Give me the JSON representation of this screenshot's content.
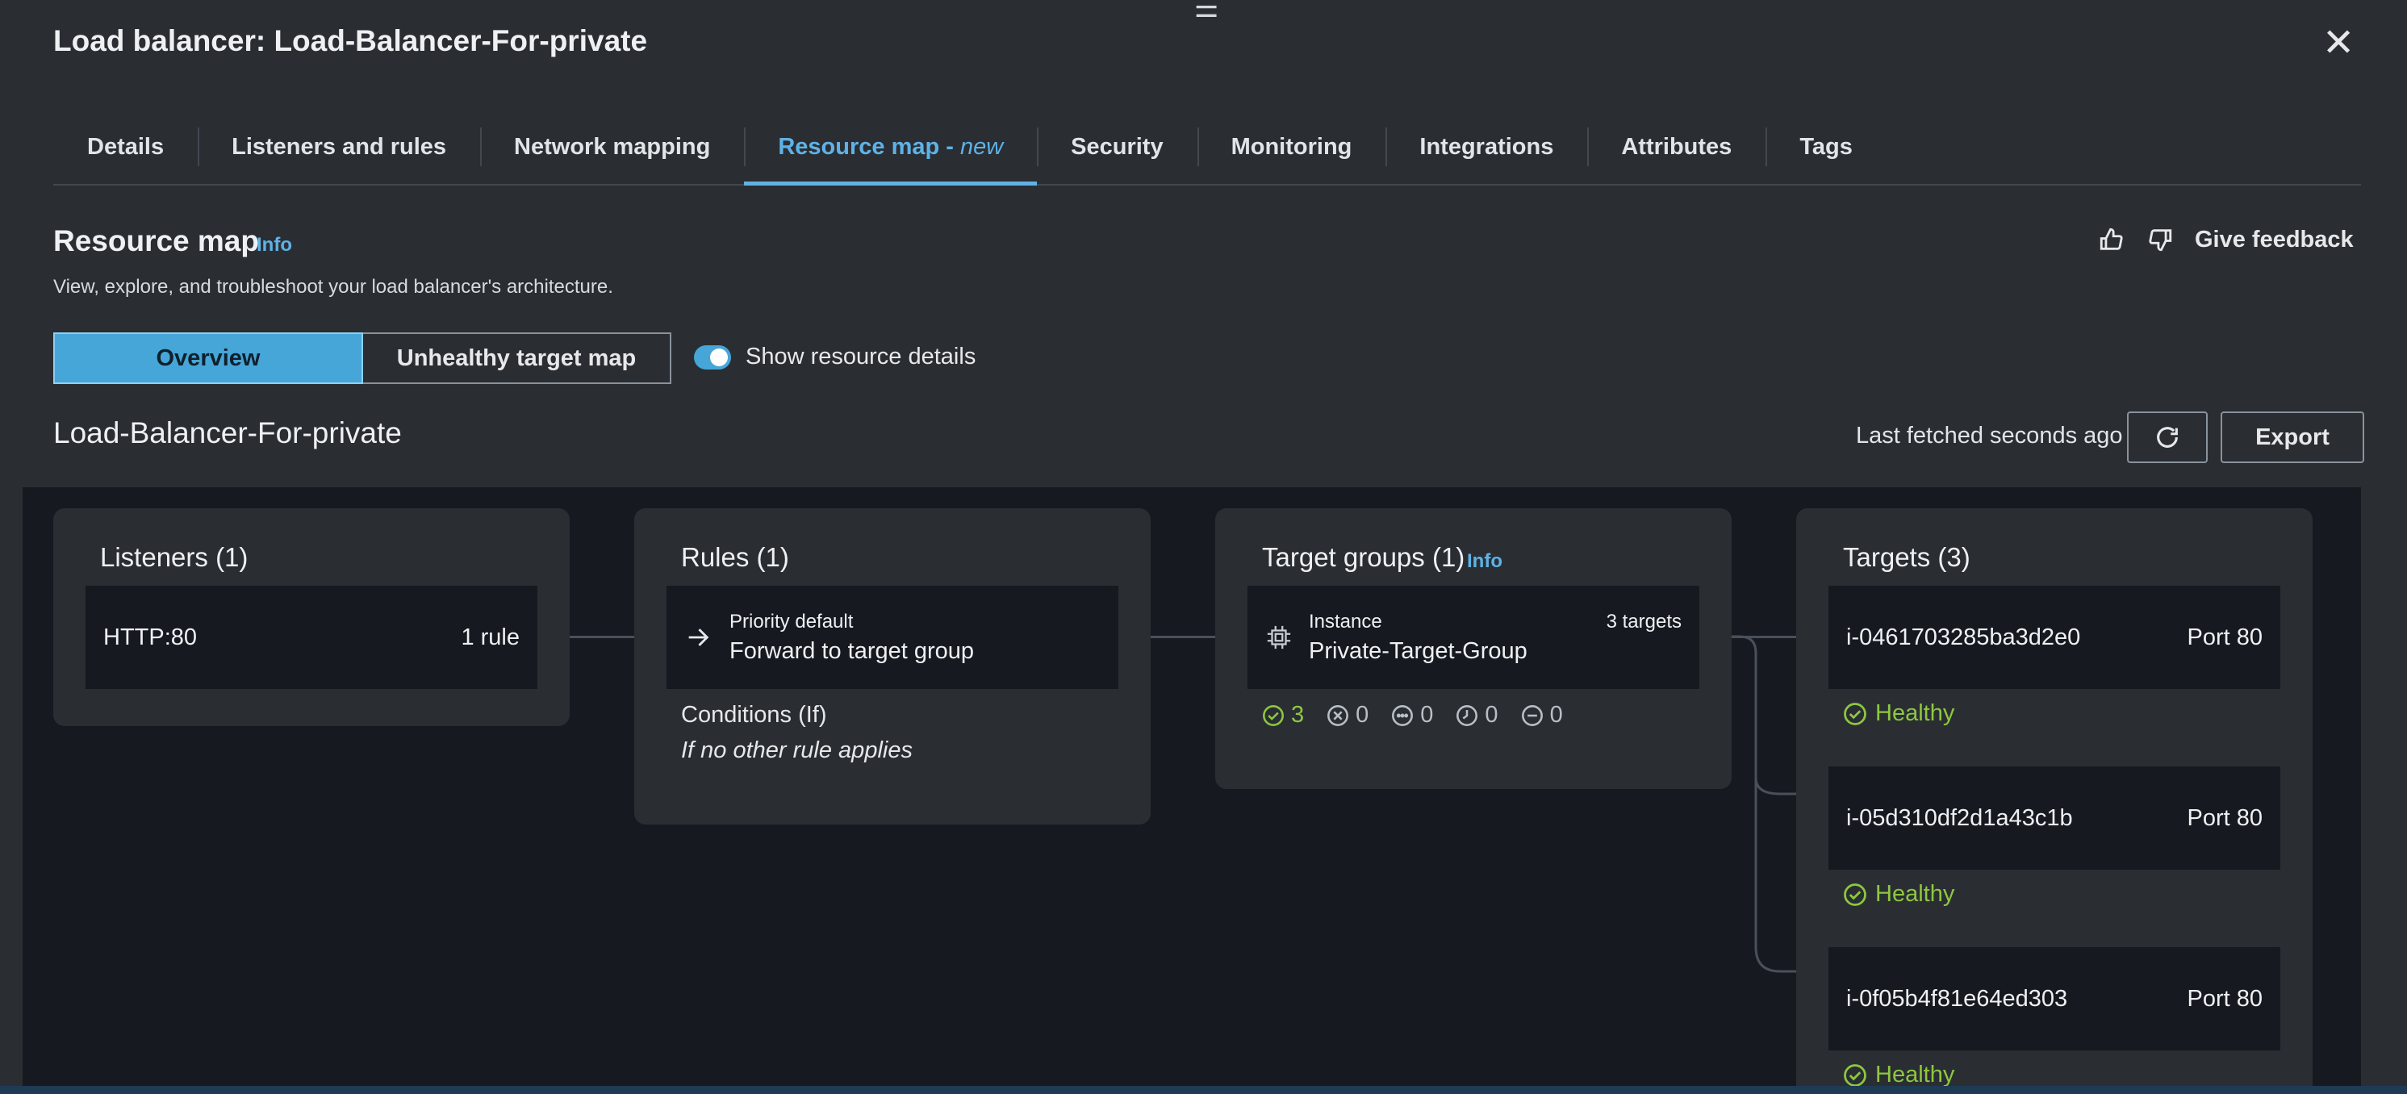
{
  "panel": {
    "title": "Load balancer: Load-Balancer-For-private",
    "drag_handle": "☰",
    "close_glyph": "✕"
  },
  "tabs": [
    {
      "label": "Details"
    },
    {
      "label": "Listeners and rules"
    },
    {
      "label": "Network mapping"
    },
    {
      "label": "Resource map -",
      "suffix": "new",
      "active": true
    },
    {
      "label": "Security"
    },
    {
      "label": "Monitoring"
    },
    {
      "label": "Integrations"
    },
    {
      "label": "Attributes"
    },
    {
      "label": "Tags"
    }
  ],
  "resource_map": {
    "title": "Resource map",
    "info": "Info",
    "description": "View, explore, and troubleshoot your load balancer's architecture.",
    "feedback_label": "Give feedback",
    "view_overview": "Overview",
    "view_unhealthy": "Unhealthy target map",
    "toggle_label": "Show resource details",
    "lb_name": "Load-Balancer-For-private",
    "last_fetched": "Last fetched seconds ago",
    "export_label": "Export"
  },
  "listeners": {
    "title": "Listeners (1)",
    "item": {
      "name": "HTTP:80",
      "rules": "1 rule"
    }
  },
  "rules": {
    "title": "Rules (1)",
    "item": {
      "priority": "Priority default",
      "action": "Forward to target group"
    },
    "conditions_label": "Conditions (If)",
    "conditions_value": "If no other rule applies"
  },
  "target_groups": {
    "title": "Target groups (1)",
    "info": "Info",
    "item": {
      "type": "Instance",
      "count": "3 targets",
      "name": "Private-Target-Group"
    },
    "status_counts": [
      "3",
      "0",
      "0",
      "0",
      "0"
    ]
  },
  "targets": {
    "title": "Targets (3)",
    "items": [
      {
        "id": "i-0461703285ba3d2e0",
        "port": "Port 80",
        "status": "Healthy"
      },
      {
        "id": "i-05d310df2d1a43c1b",
        "port": "Port 80",
        "status": "Healthy"
      },
      {
        "id": "i-0f05b4f81e64ed303",
        "port": "Port 80",
        "status": "Healthy"
      }
    ]
  },
  "colors": {
    "accent": "#5fb2e6",
    "healthy": "#8ec73f",
    "canvas": "#161a20",
    "panel": "#2a2e33"
  }
}
